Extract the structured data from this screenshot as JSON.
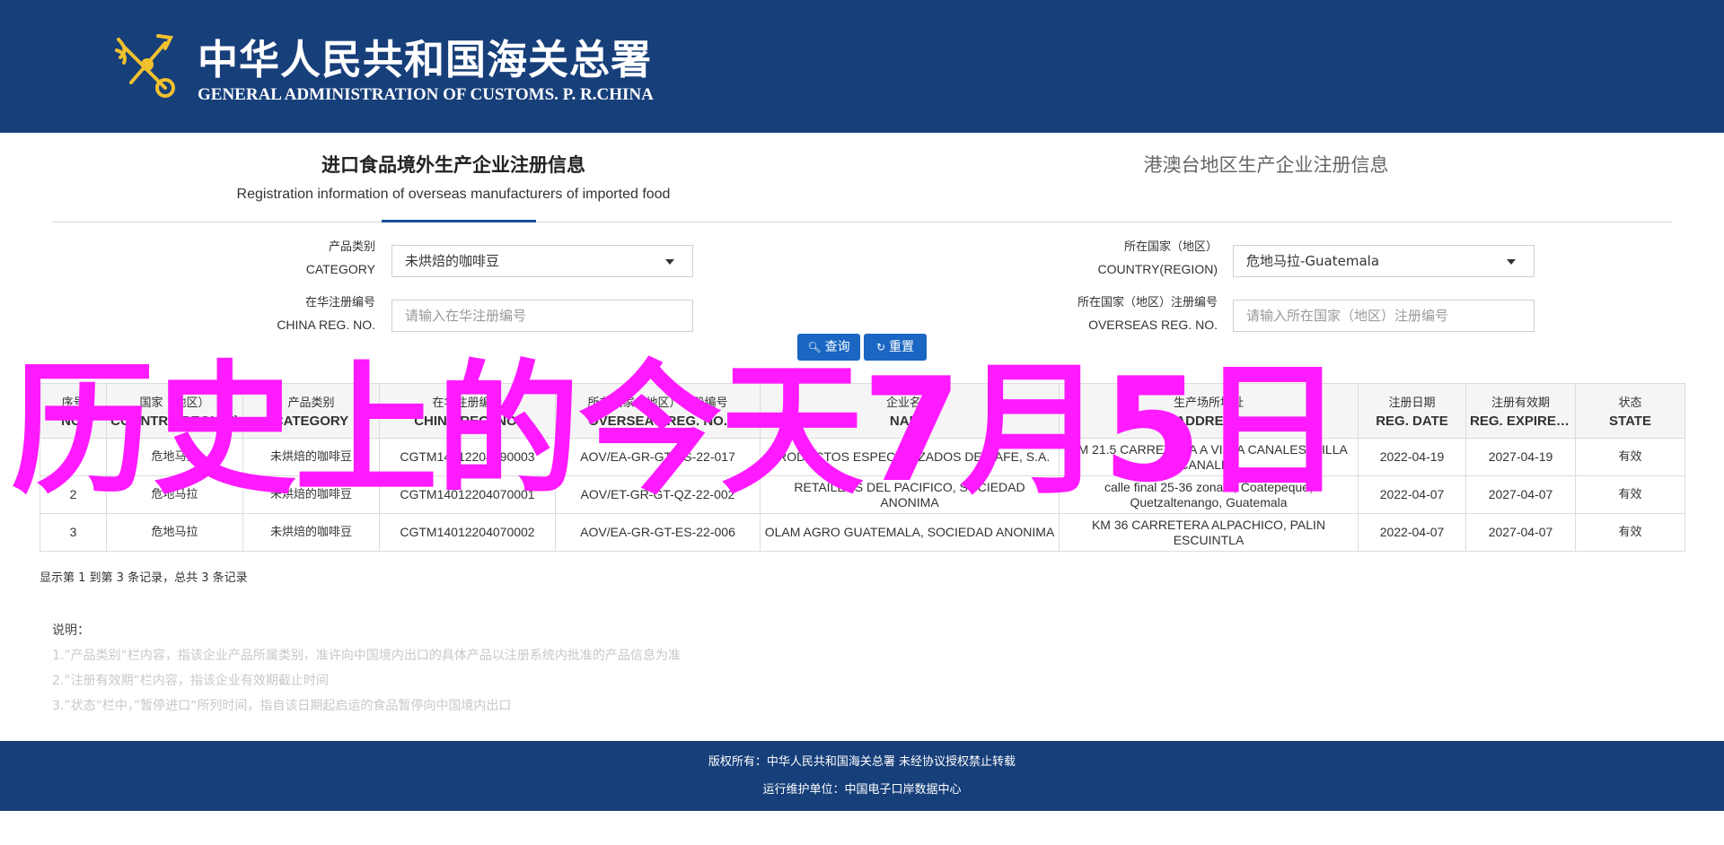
{
  "header": {
    "title_cn": "中华人民共和国海关总署",
    "title_en": "GENERAL ADMINISTRATION OF CUSTOMS. P. R.CHINA",
    "logo_icon": "customs-emblem-icon"
  },
  "tabs": [
    {
      "cn": "进口食品境外生产企业注册信息",
      "en": "Registration information of overseas manufacturers of imported food",
      "active": true
    },
    {
      "cn": "港澳台地区生产企业注册信息",
      "en": "",
      "active": false
    }
  ],
  "filters": {
    "category": {
      "label_cn": "产品类别",
      "label_en": "CATEGORY",
      "value": "未烘焙的咖啡豆"
    },
    "country": {
      "label_cn": "所在国家（地区）",
      "label_en": "COUNTRY(REGION)",
      "value": "危地马拉-Guatemala"
    },
    "china_reg": {
      "label_cn": "在华注册编号",
      "label_en": "CHINA REG. NO.",
      "placeholder": "请输入在华注册编号"
    },
    "overseas_reg": {
      "label_cn": "所在国家（地区）注册编号",
      "label_en": "OVERSEAS REG. NO.",
      "placeholder": "请输入所在国家（地区）注册编号"
    }
  },
  "buttons": {
    "search": "查询",
    "reset": "重置"
  },
  "table": {
    "headers": [
      {
        "cn": "序号",
        "en": "NO."
      },
      {
        "cn": "国家（地区）",
        "en": "COUNTRY(REGION)"
      },
      {
        "cn": "产品类别",
        "en": "CATEGORY"
      },
      {
        "cn": "在华注册编号",
        "en": "CHINA REG. NO."
      },
      {
        "cn": "所在国家（地区）注册编号",
        "en": "OVERSEAS REG. NO."
      },
      {
        "cn": "企业名称",
        "en": "NAME"
      },
      {
        "cn": "生产场所地址",
        "en": "ADDRESS"
      },
      {
        "cn": "注册日期",
        "en": "REG. DATE"
      },
      {
        "cn": "注册有效期",
        "en": "REG. EXPIRED DATE"
      },
      {
        "cn": "状态",
        "en": "STATE"
      }
    ],
    "rows": [
      [
        "1",
        "危地马拉",
        "未烘焙的咖啡豆",
        "CGTM14012204190003",
        "AOV/EA-GR-GT-ES-22-017",
        "PRODUCTOS ESPECIALIZADOS DE CAFE, S.A.",
        "KM 21.5 CARRETERA A VILLA CANALES, VILLA CANALES",
        "2022-04-19",
        "2027-04-19",
        "有效"
      ],
      [
        "2",
        "危地马拉",
        "未烘焙的咖啡豆",
        "CGTM14012204070001",
        "AOV/ET-GR-GT-QZ-22-002",
        "RETAILERS DEL PACIFICO, SOCIEDAD ANONIMA",
        "calle final 25-36 zona 1, Coatepeque, Quetzaltenango, Guatemala",
        "2022-04-07",
        "2027-04-07",
        "有效"
      ],
      [
        "3",
        "危地马拉",
        "未烘焙的咖啡豆",
        "CGTM14012204070002",
        "AOV/EA-GR-GT-ES-22-006",
        "OLAM AGRO GUATEMALA, SOCIEDAD ANONIMA",
        "KM 36 CARRETERA ALPACHICO, PALIN ESCUINTLA",
        "2022-04-07",
        "2027-04-07",
        "有效"
      ]
    ]
  },
  "summary": "显示第 1 到第 3 条记录，总共 3 条记录",
  "notes": {
    "title": "说明：",
    "lines": [
      "1.”产品类别“栏内容，指该企业产品所属类别，准许向中国境内出口的具体产品以注册系统内批准的产品信息为准",
      "2.”注册有效期“栏内容，指该企业有效期截止时间",
      "3.”状态“栏中，”暂停进口“所列时间，指自该日期起启运的食品暂停向中国境内出口"
    ]
  },
  "overlay": "历史上的今天7月5日",
  "footer": {
    "copyright": "版权所有：中华人民共和国海关总署 未经协议授权禁止转载",
    "maintainer": "运行维护单位：中国电子口岸数据中心"
  },
  "colors": {
    "header_bg": "#173f7a",
    "overlay": "#ff1aff",
    "button": "#1a66c2"
  }
}
